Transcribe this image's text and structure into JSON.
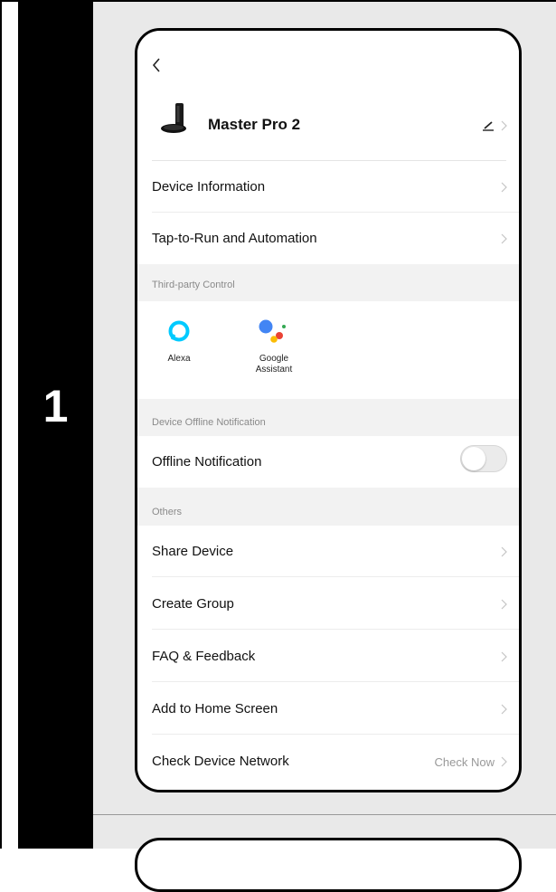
{
  "step": {
    "number": "1"
  },
  "device": {
    "name": "Master Pro 2",
    "icon": "robot-vacuum-icon"
  },
  "rows": {
    "device_information": "Device Information",
    "tap_to_run": "Tap-to-Run and Automation",
    "offline_notification": "Offline Notification",
    "share_device": "Share Device",
    "create_group": "Create Group",
    "faq_feedback": "FAQ & Feedback",
    "add_home_screen": "Add to Home Screen",
    "check_network": "Check Device Network",
    "check_now": "Check Now"
  },
  "sections": {
    "third_party": "Third-party Control",
    "offline": "Device Offline Notification",
    "others": "Others"
  },
  "services": {
    "alexa": "Alexa",
    "google_line1": "Google",
    "google_line2": "Assistant"
  },
  "toggles": {
    "offline_notification_on": false
  },
  "colors": {
    "alexa": "#00caff",
    "google_blue": "#4285f4",
    "google_red": "#ea4335",
    "google_yellow": "#fbbc05",
    "google_green": "#34a853"
  }
}
